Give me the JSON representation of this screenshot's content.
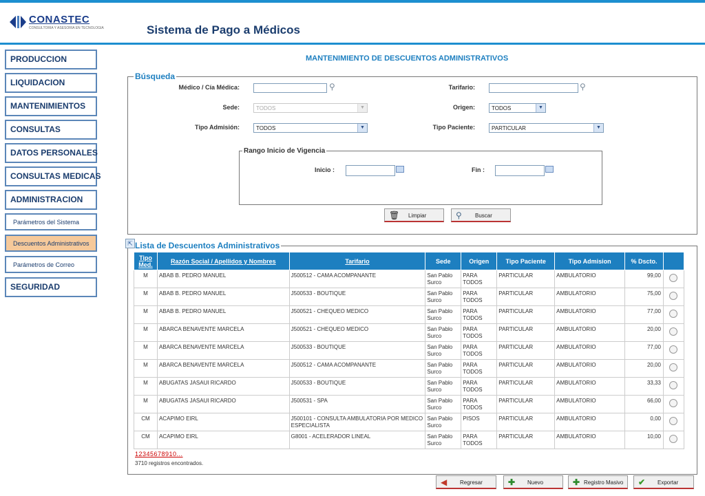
{
  "brand": {
    "name": "CONASTEC",
    "tagline": "CONSULTORIA Y ASESORIA EN TECNOLOGIA"
  },
  "app_title": "Sistema de Pago a Médicos",
  "colors": {
    "accent": "#1d7fc0",
    "nav_border": "#5b86b8",
    "active_item": "#f6c99a"
  },
  "sidebar": {
    "items": [
      {
        "label": "PRODUCCION"
      },
      {
        "label": "LIQUIDACION"
      },
      {
        "label": "MANTENIMIENTOS"
      },
      {
        "label": "CONSULTAS"
      },
      {
        "label": "DATOS PERSONALES"
      },
      {
        "label": "CONSULTAS MEDICAS"
      },
      {
        "label": "ADMINISTRACION"
      }
    ],
    "sub_items": [
      {
        "label": "Parámetros del Sistema"
      },
      {
        "label": "Descuentos Administrativos"
      },
      {
        "label": "Parámetros de Correo"
      }
    ],
    "last_item": {
      "label": "SEGURIDAD"
    }
  },
  "page_heading": "MANTENIMIENTO DE DESCUENTOS ADMINISTRATIVOS",
  "search": {
    "legend": "Búsqueda",
    "medico_label": "Médico / Cía Médica:",
    "medico_value": "",
    "tarifario_label": "Tarifario:",
    "tarifario_value": "",
    "sede_label": "Sede:",
    "sede_value": "TODOS",
    "origen_label": "Origen:",
    "origen_value": "TODOS",
    "tipo_admision_label": "Tipo Admisión:",
    "tipo_admision_value": "TODOS",
    "tipo_paciente_label": "Tipo Paciente:",
    "tipo_paciente_value": "PARTICULAR",
    "range_legend": "Rango Inicio de Vigencia",
    "inicio_label": "Inicio :",
    "fin_label": "Fin :",
    "limpiar_label": "Limpiar",
    "buscar_label": "Buscar"
  },
  "list": {
    "legend": "Lista de Descuentos Administrativos",
    "columns": [
      "Tipo Med.",
      "Razón Social / Apellidos y Nombres",
      "Tarifario",
      "Sede",
      "Origen",
      "Tipo Paciente",
      "Tipo Admision",
      "% Dscto."
    ],
    "rows": [
      {
        "tipo": "M",
        "razon": "ABAB B. PEDRO MANUEL",
        "tarifario": "J500512 - CAMA ACOMPANANTE",
        "sede": "San Pablo Surco",
        "origen": "PARA TODOS",
        "paciente": "PARTICULAR",
        "admision": "AMBULATORIO",
        "dscto": "99,00"
      },
      {
        "tipo": "M",
        "razon": "ABAB B. PEDRO MANUEL",
        "tarifario": "J500533 - BOUTIQUE",
        "sede": "San Pablo Surco",
        "origen": "PARA TODOS",
        "paciente": "PARTICULAR",
        "admision": "AMBULATORIO",
        "dscto": "75,00"
      },
      {
        "tipo": "M",
        "razon": "ABAB B. PEDRO MANUEL",
        "tarifario": "J500521 - CHEQUEO MEDICO",
        "sede": "San Pablo Surco",
        "origen": "PARA TODOS",
        "paciente": "PARTICULAR",
        "admision": "AMBULATORIO",
        "dscto": "77,00"
      },
      {
        "tipo": "M",
        "razon": "ABARCA BENAVENTE MARCELA",
        "tarifario": "J500521 - CHEQUEO MEDICO",
        "sede": "San Pablo Surco",
        "origen": "PARA TODOS",
        "paciente": "PARTICULAR",
        "admision": "AMBULATORIO",
        "dscto": "20,00"
      },
      {
        "tipo": "M",
        "razon": "ABARCA BENAVENTE MARCELA",
        "tarifario": "J500533 - BOUTIQUE",
        "sede": "San Pablo Surco",
        "origen": "PARA TODOS",
        "paciente": "PARTICULAR",
        "admision": "AMBULATORIO",
        "dscto": "77,00"
      },
      {
        "tipo": "M",
        "razon": "ABARCA BENAVENTE MARCELA",
        "tarifario": "J500512 - CAMA ACOMPANANTE",
        "sede": "San Pablo Surco",
        "origen": "PARA TODOS",
        "paciente": "PARTICULAR",
        "admision": "AMBULATORIO",
        "dscto": "20,00"
      },
      {
        "tipo": "M",
        "razon": "ABUGATAS JASAUI RICARDO",
        "tarifario": "J500533 - BOUTIQUE",
        "sede": "San Pablo Surco",
        "origen": "PARA TODOS",
        "paciente": "PARTICULAR",
        "admision": "AMBULATORIO",
        "dscto": "33,33"
      },
      {
        "tipo": "M",
        "razon": "ABUGATAS JASAUI RICARDO",
        "tarifario": "J500531 - SPA",
        "sede": "San Pablo Surco",
        "origen": "PARA TODOS",
        "paciente": "PARTICULAR",
        "admision": "AMBULATORIO",
        "dscto": "66,00"
      },
      {
        "tipo": "CM",
        "razon": "ACAPIMO EIRL",
        "tarifario": "J500101 - CONSULTA AMBULATORIA POR MEDICO ESPECIALISTA",
        "sede": "San Pablo Surco",
        "origen": "PISOS",
        "paciente": "PARTICULAR",
        "admision": "AMBULATORIO",
        "dscto": "0,00"
      },
      {
        "tipo": "CM",
        "razon": "ACAPIMO EIRL",
        "tarifario": "G8001 - ACELERADOR LINEAL",
        "sede": "San Pablo Surco",
        "origen": "PARA TODOS",
        "paciente": "PARTICULAR",
        "admision": "AMBULATORIO",
        "dscto": "10,00"
      }
    ],
    "pager": "12345678910...",
    "count": "3710 registros encontrados."
  },
  "actions": {
    "regresar": "Regresar",
    "nuevo": "Nuevo",
    "registro_masivo": "Registro Masivo",
    "exportar": "Exportar"
  }
}
